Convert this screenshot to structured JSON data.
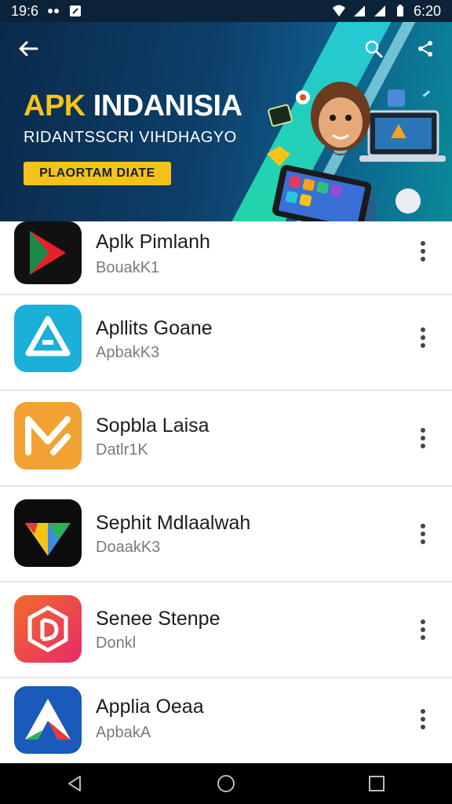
{
  "status_bar": {
    "time_left": "19:6",
    "time_right": "6:20"
  },
  "banner": {
    "title_yellow": "APK",
    "title_white": "INDANISIA",
    "subtitle": "RIDANTSSCRI VIHDHAGYO",
    "badge": "PLAORTAM DIATE"
  },
  "toolbar": {
    "back_icon": "arrow-left-icon",
    "search_icon": "search-icon",
    "share_icon": "share-icon"
  },
  "apps": [
    {
      "name": "Aplk Pimlanh",
      "developer": "BouakK1"
    },
    {
      "name": "Apllits Goane",
      "developer": "ApbakK3"
    },
    {
      "name": "Sopbla Laisa",
      "developer": "Datlr1K"
    },
    {
      "name": "Sephit Mdlaalwah",
      "developer": "DoaakK3"
    },
    {
      "name": "Senee Stenpe",
      "developer": "Donkl"
    },
    {
      "name": "Applia Oeaa",
      "developer": "ApbakA"
    }
  ],
  "colors": {
    "accent": "#f5c21a",
    "banner_dark": "#0d3f6a",
    "teal": "#27c7d8"
  },
  "nav": {
    "back_icon": "triangle-back-icon",
    "home_icon": "circle-home-icon",
    "recents_icon": "square-recents-icon"
  }
}
